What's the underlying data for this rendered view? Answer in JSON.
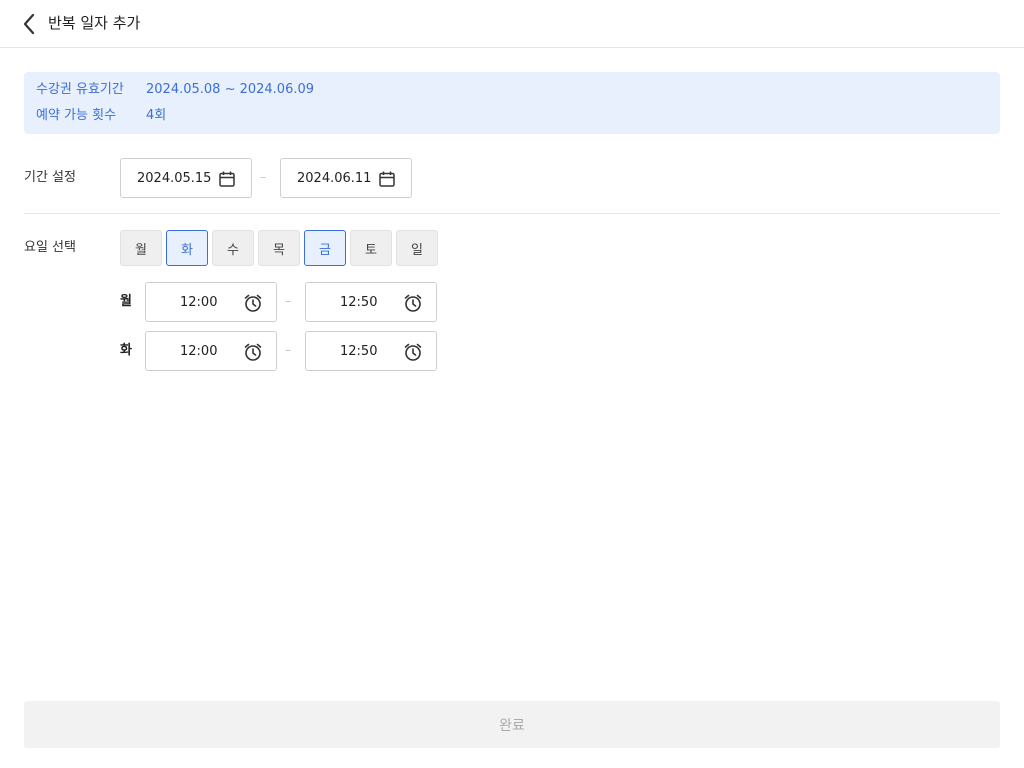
{
  "header": {
    "title": "반복 일자 추가",
    "back_icon": "chevron-left-icon"
  },
  "info": {
    "validity_label": "수강권 유효기간",
    "validity_value": "2024.05.08 ~ 2024.06.09",
    "count_label": "예약 가능 횟수",
    "count_value": "4회",
    "color": "#3b6fd6",
    "background": "#e8f0fe"
  },
  "period": {
    "label": "기간 설정",
    "start": "2024.05.15",
    "end": "2024.06.11",
    "separator": "–",
    "icon": "calendar-icon"
  },
  "days": {
    "label": "요일 선택",
    "items": [
      {
        "label": "월",
        "selected": false
      },
      {
        "label": "화",
        "selected": true
      },
      {
        "label": "수",
        "selected": false
      },
      {
        "label": "목",
        "selected": false
      },
      {
        "label": "금",
        "selected": true
      },
      {
        "label": "토",
        "selected": false
      },
      {
        "label": "일",
        "selected": false
      }
    ]
  },
  "times": [
    {
      "day": "월",
      "start": "12:00",
      "end": "12:50",
      "separator": "–"
    },
    {
      "day": "화",
      "start": "12:00",
      "end": "12:50",
      "separator": "–"
    }
  ],
  "footer": {
    "complete_label": "완료"
  }
}
